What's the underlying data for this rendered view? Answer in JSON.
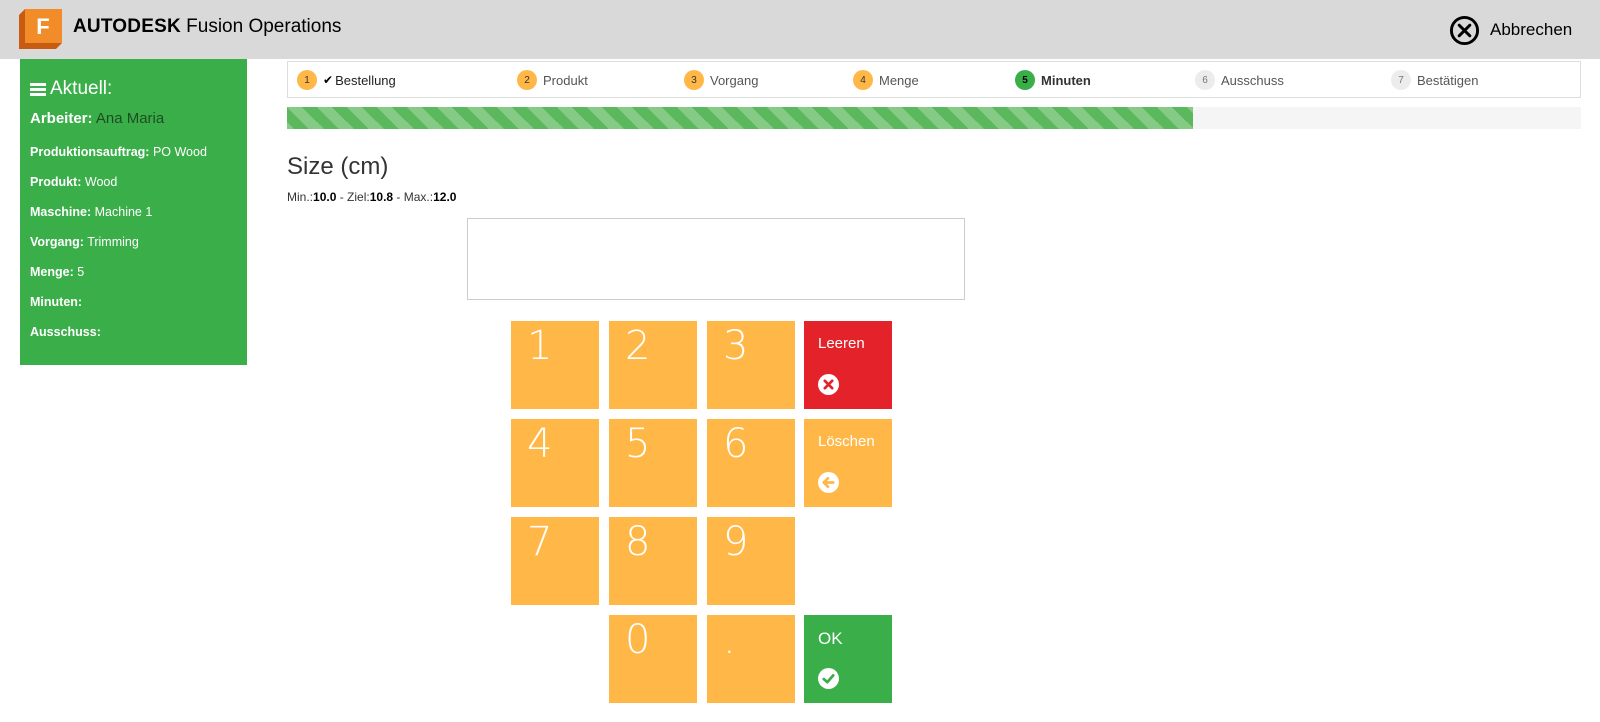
{
  "header": {
    "brand_bold": "AUTODESK",
    "brand_rest": " Fusion Operations",
    "logo_letter": "F",
    "cancel_label": "Abbrechen",
    "cancel_icon": "circle-x-icon"
  },
  "sidebar": {
    "title": "Aktuell:",
    "worker_label": "Arbeiter:",
    "worker_value": "Ana Maria",
    "rows": [
      {
        "label": "Produktionsauftrag:",
        "value": "PO Wood"
      },
      {
        "label": "Produkt:",
        "value": "Wood"
      },
      {
        "label": "Maschine:",
        "value": "Machine 1"
      },
      {
        "label": "Vorgang:",
        "value": "Trimming"
      },
      {
        "label": "Menge:",
        "value": "5"
      },
      {
        "label": "Minuten:",
        "value": ""
      },
      {
        "label": "Ausschuss:",
        "value": ""
      }
    ]
  },
  "steps": [
    {
      "num": "1",
      "label": "Bestellung",
      "state": "done"
    },
    {
      "num": "2",
      "label": "Produkt",
      "state": "done"
    },
    {
      "num": "3",
      "label": "Vorgang",
      "state": "done"
    },
    {
      "num": "4",
      "label": "Menge",
      "state": "done"
    },
    {
      "num": "5",
      "label": "Minuten",
      "state": "active"
    },
    {
      "num": "6",
      "label": "Ausschuss",
      "state": "todo"
    },
    {
      "num": "7",
      "label": "Bestätigen",
      "state": "todo"
    }
  ],
  "progress": {
    "fraction": 0.7
  },
  "field": {
    "title": "Size (cm)",
    "min_label": "Min.:",
    "min_value": "10.0",
    "target_label": " - Ziel:",
    "target_value": "10.8",
    "max_label": " - Max.:",
    "max_value": "12.0",
    "display_value": ""
  },
  "keypad": {
    "digits": [
      "1",
      "2",
      "3",
      "4",
      "5",
      "6",
      "7",
      "8",
      "9",
      "0",
      "."
    ],
    "clear_label": "Leeren",
    "delete_label": "Löschen",
    "ok_label": "OK"
  },
  "colors": {
    "green": "#3aae49",
    "orange": "#ffb847",
    "red": "#e3222a",
    "header_bg": "#d9d9d9"
  }
}
